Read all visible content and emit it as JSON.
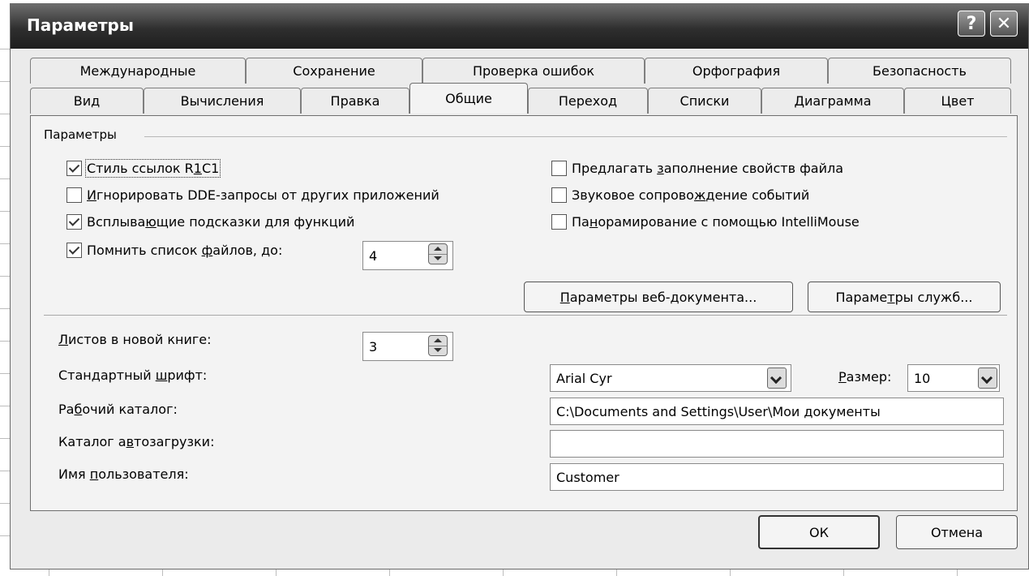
{
  "window": {
    "title": "Параметры",
    "help_glyph": "?",
    "close_glyph": "✕"
  },
  "tabs_row_back": [
    {
      "label": "Международные"
    },
    {
      "label": "Сохранение"
    },
    {
      "label": "Проверка ошибок"
    },
    {
      "label": "Орфография"
    },
    {
      "label": "Безопасность"
    }
  ],
  "tabs_row_front": [
    {
      "label": "Вид"
    },
    {
      "label": "Вычисления"
    },
    {
      "label": "Правка"
    },
    {
      "label": "Общие",
      "active": true
    },
    {
      "label": "Переход"
    },
    {
      "label": "Списки"
    },
    {
      "label": "Диаграмма"
    },
    {
      "label": "Цвет"
    }
  ],
  "group": {
    "label": "Параметры"
  },
  "options": {
    "r1c1": {
      "pre": "Стиль ссылок R",
      "key": "1",
      "post": "C1",
      "checked": true
    },
    "ignore_dde": {
      "pre": "",
      "key": "И",
      "post": "гнорировать DDE-запросы от других приложений",
      "checked": false
    },
    "tooltips": {
      "pre": "Всплыва",
      "key": "ю",
      "post": "щие подсказки для функций",
      "checked": true
    },
    "recent_files": {
      "pre": "Помнить список ",
      "key": "ф",
      "post": "айлов, до:",
      "checked": true
    },
    "file_props": {
      "pre": "Предлагать ",
      "key": "з",
      "post": "аполнение свойств файла",
      "checked": false
    },
    "sound": {
      "pre": "Звуковое сопрово",
      "key": "ж",
      "post": "дение событий",
      "checked": false
    },
    "intellimouse": {
      "pre": "Па",
      "key": "н",
      "post": "орамирование с помощью IntelliMouse",
      "checked": false
    }
  },
  "recent_files_count": "4",
  "buttons": {
    "web_options": {
      "key": "П",
      "post": "араметры веб-документа..."
    },
    "service_options": {
      "pre": "Параме",
      "key": "т",
      "post": "ры служб..."
    },
    "ok": "ОК",
    "cancel": "Отмена"
  },
  "settings": {
    "sheets": {
      "key": "Л",
      "post": "истов в новой книге:",
      "value": "3"
    },
    "font": {
      "pre": "Стандартный ",
      "key": "ш",
      "post": "рифт:",
      "value": "Arial Cyr"
    },
    "size": {
      "key": "Р",
      "post": "азмер:",
      "value": "10"
    },
    "workdir": {
      "pre": "Ра",
      "key": "б",
      "post": "очий каталог:",
      "value": "C:\\Documents and Settings\\User\\Мои документы"
    },
    "autoload": {
      "pre": "Каталог а",
      "key": "в",
      "post": "тозагрузки:",
      "value": ""
    },
    "username": {
      "pre": "Имя ",
      "key": "п",
      "post": "ользователя:",
      "value": "Customer"
    }
  }
}
